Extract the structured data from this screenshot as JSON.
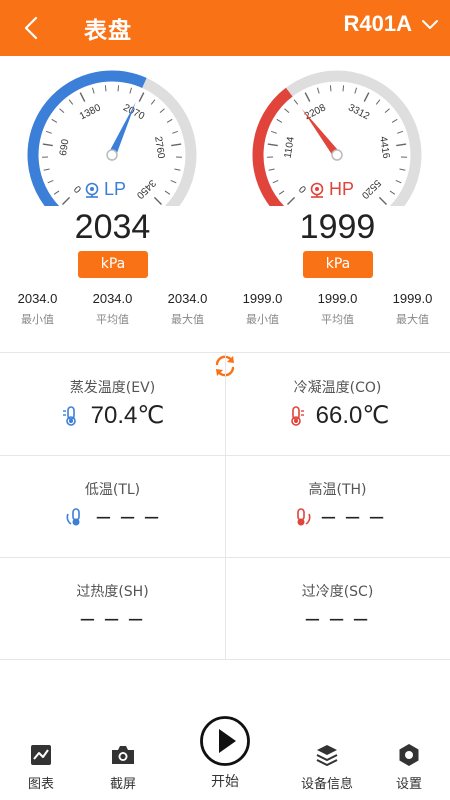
{
  "header": {
    "title": "表盘",
    "refrigerant": "R401A"
  },
  "gauges": {
    "lp": {
      "label": "LP",
      "ticks": [
        "0",
        "690",
        "1380",
        "2070",
        "2760",
        "3450"
      ],
      "max": 3450,
      "reading": "2034",
      "needle_value": 2034,
      "unit": "kPa",
      "color": "#3b7fd8",
      "stats": [
        {
          "value": "2034.0",
          "label": "最小值"
        },
        {
          "value": "2034.0",
          "label": "平均值"
        },
        {
          "value": "2034.0",
          "label": "最大值"
        }
      ]
    },
    "hp": {
      "label": "HP",
      "ticks": [
        "0",
        "1104",
        "2208",
        "3312",
        "4416",
        "5520"
      ],
      "max": 5520,
      "reading": "1999",
      "needle_value": 1999,
      "unit": "kPa",
      "color": "#e0443a",
      "stats": [
        {
          "value": "1999.0",
          "label": "最小值"
        },
        {
          "value": "1999.0",
          "label": "平均值"
        },
        {
          "value": "1999.0",
          "label": "最大值"
        }
      ]
    }
  },
  "metrics": {
    "ev": {
      "label": "蒸发温度(EV)",
      "value": "70.4℃"
    },
    "co": {
      "label": "冷凝温度(CO)",
      "value": "66.0℃"
    },
    "tl": {
      "label": "低温(TL)",
      "value": "– – –"
    },
    "th": {
      "label": "高温(TH)",
      "value": "– – –"
    },
    "sh": {
      "label": "过热度(SH)",
      "value": "– – –"
    },
    "sc": {
      "label": "过冷度(SC)",
      "value": "– – –"
    }
  },
  "nav": {
    "chart": "图表",
    "screenshot": "截屏",
    "start": "开始",
    "device_info": "设备信息",
    "settings": "设置"
  },
  "colors": {
    "accent": "#f97316",
    "lp": "#3b7fd8",
    "hp": "#e0443a"
  }
}
